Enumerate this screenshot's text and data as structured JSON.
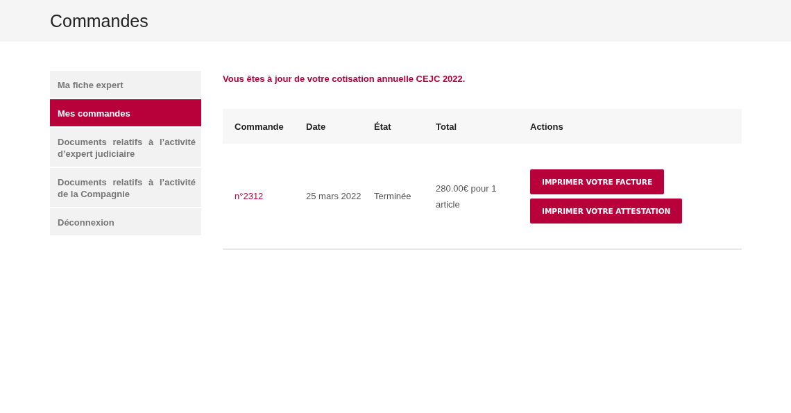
{
  "page_title": "Commandes",
  "sidebar": {
    "items": [
      {
        "label": "Ma fiche expert",
        "selected": false
      },
      {
        "label": "Mes commandes",
        "selected": true
      },
      {
        "label": "Documents relatifs à l’activité d’expert judiciaire",
        "selected": false
      },
      {
        "label": "Documents relatifs à l’activité de la Compagnie",
        "selected": false
      },
      {
        "label": "Déconnexion",
        "selected": false
      }
    ]
  },
  "notice": "Vous êtes à jour de votre cotisation annuelle CEJC 2022.",
  "table": {
    "columns": [
      "Commande",
      "Date",
      "État",
      "Total",
      "Actions"
    ],
    "rows": [
      {
        "order": "n°2312",
        "date": "25 mars 2022",
        "status": "Terminée",
        "total": "280.00€ pour 1 article",
        "actions": [
          "IMPRIMER VOTRE FACTURE",
          "IMPRIMER VOTRE ATTESTATION"
        ]
      }
    ]
  }
}
